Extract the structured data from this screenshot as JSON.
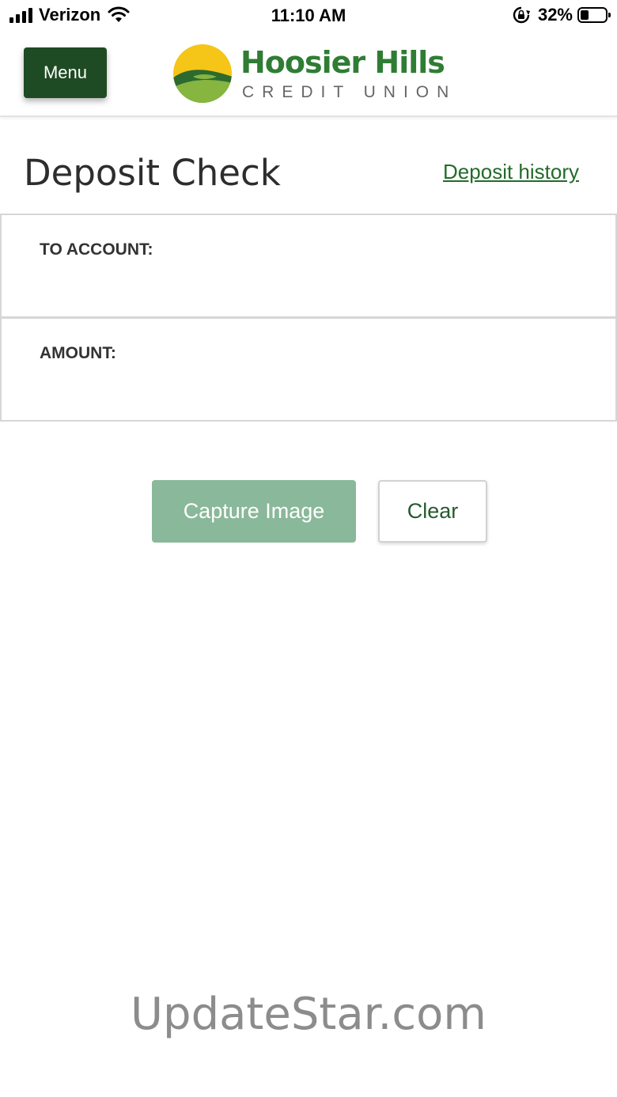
{
  "status_bar": {
    "carrier": "Verizon",
    "time": "11:10 AM",
    "battery_percent": "32%",
    "battery_level": 0.32,
    "icons": [
      "signal-icon",
      "wifi-icon",
      "rotation-lock-icon",
      "battery-icon"
    ]
  },
  "header": {
    "menu_label": "Menu",
    "logo_name": "Hoosier Hills",
    "logo_sub": "CREDIT UNION"
  },
  "page": {
    "title": "Deposit Check",
    "history_link": "Deposit history"
  },
  "form": {
    "to_account_label": "TO ACCOUNT:",
    "amount_label": "AMOUNT:"
  },
  "actions": {
    "capture_label": "Capture Image",
    "clear_label": "Clear"
  },
  "watermark": "UpdateStar.com",
  "colors": {
    "brand_dark_green": "#1e4b23",
    "brand_green": "#2f7d34",
    "capture_disabled": "#8ab89a",
    "logo_yellow": "#f5c518",
    "link_green": "#236b2a"
  }
}
